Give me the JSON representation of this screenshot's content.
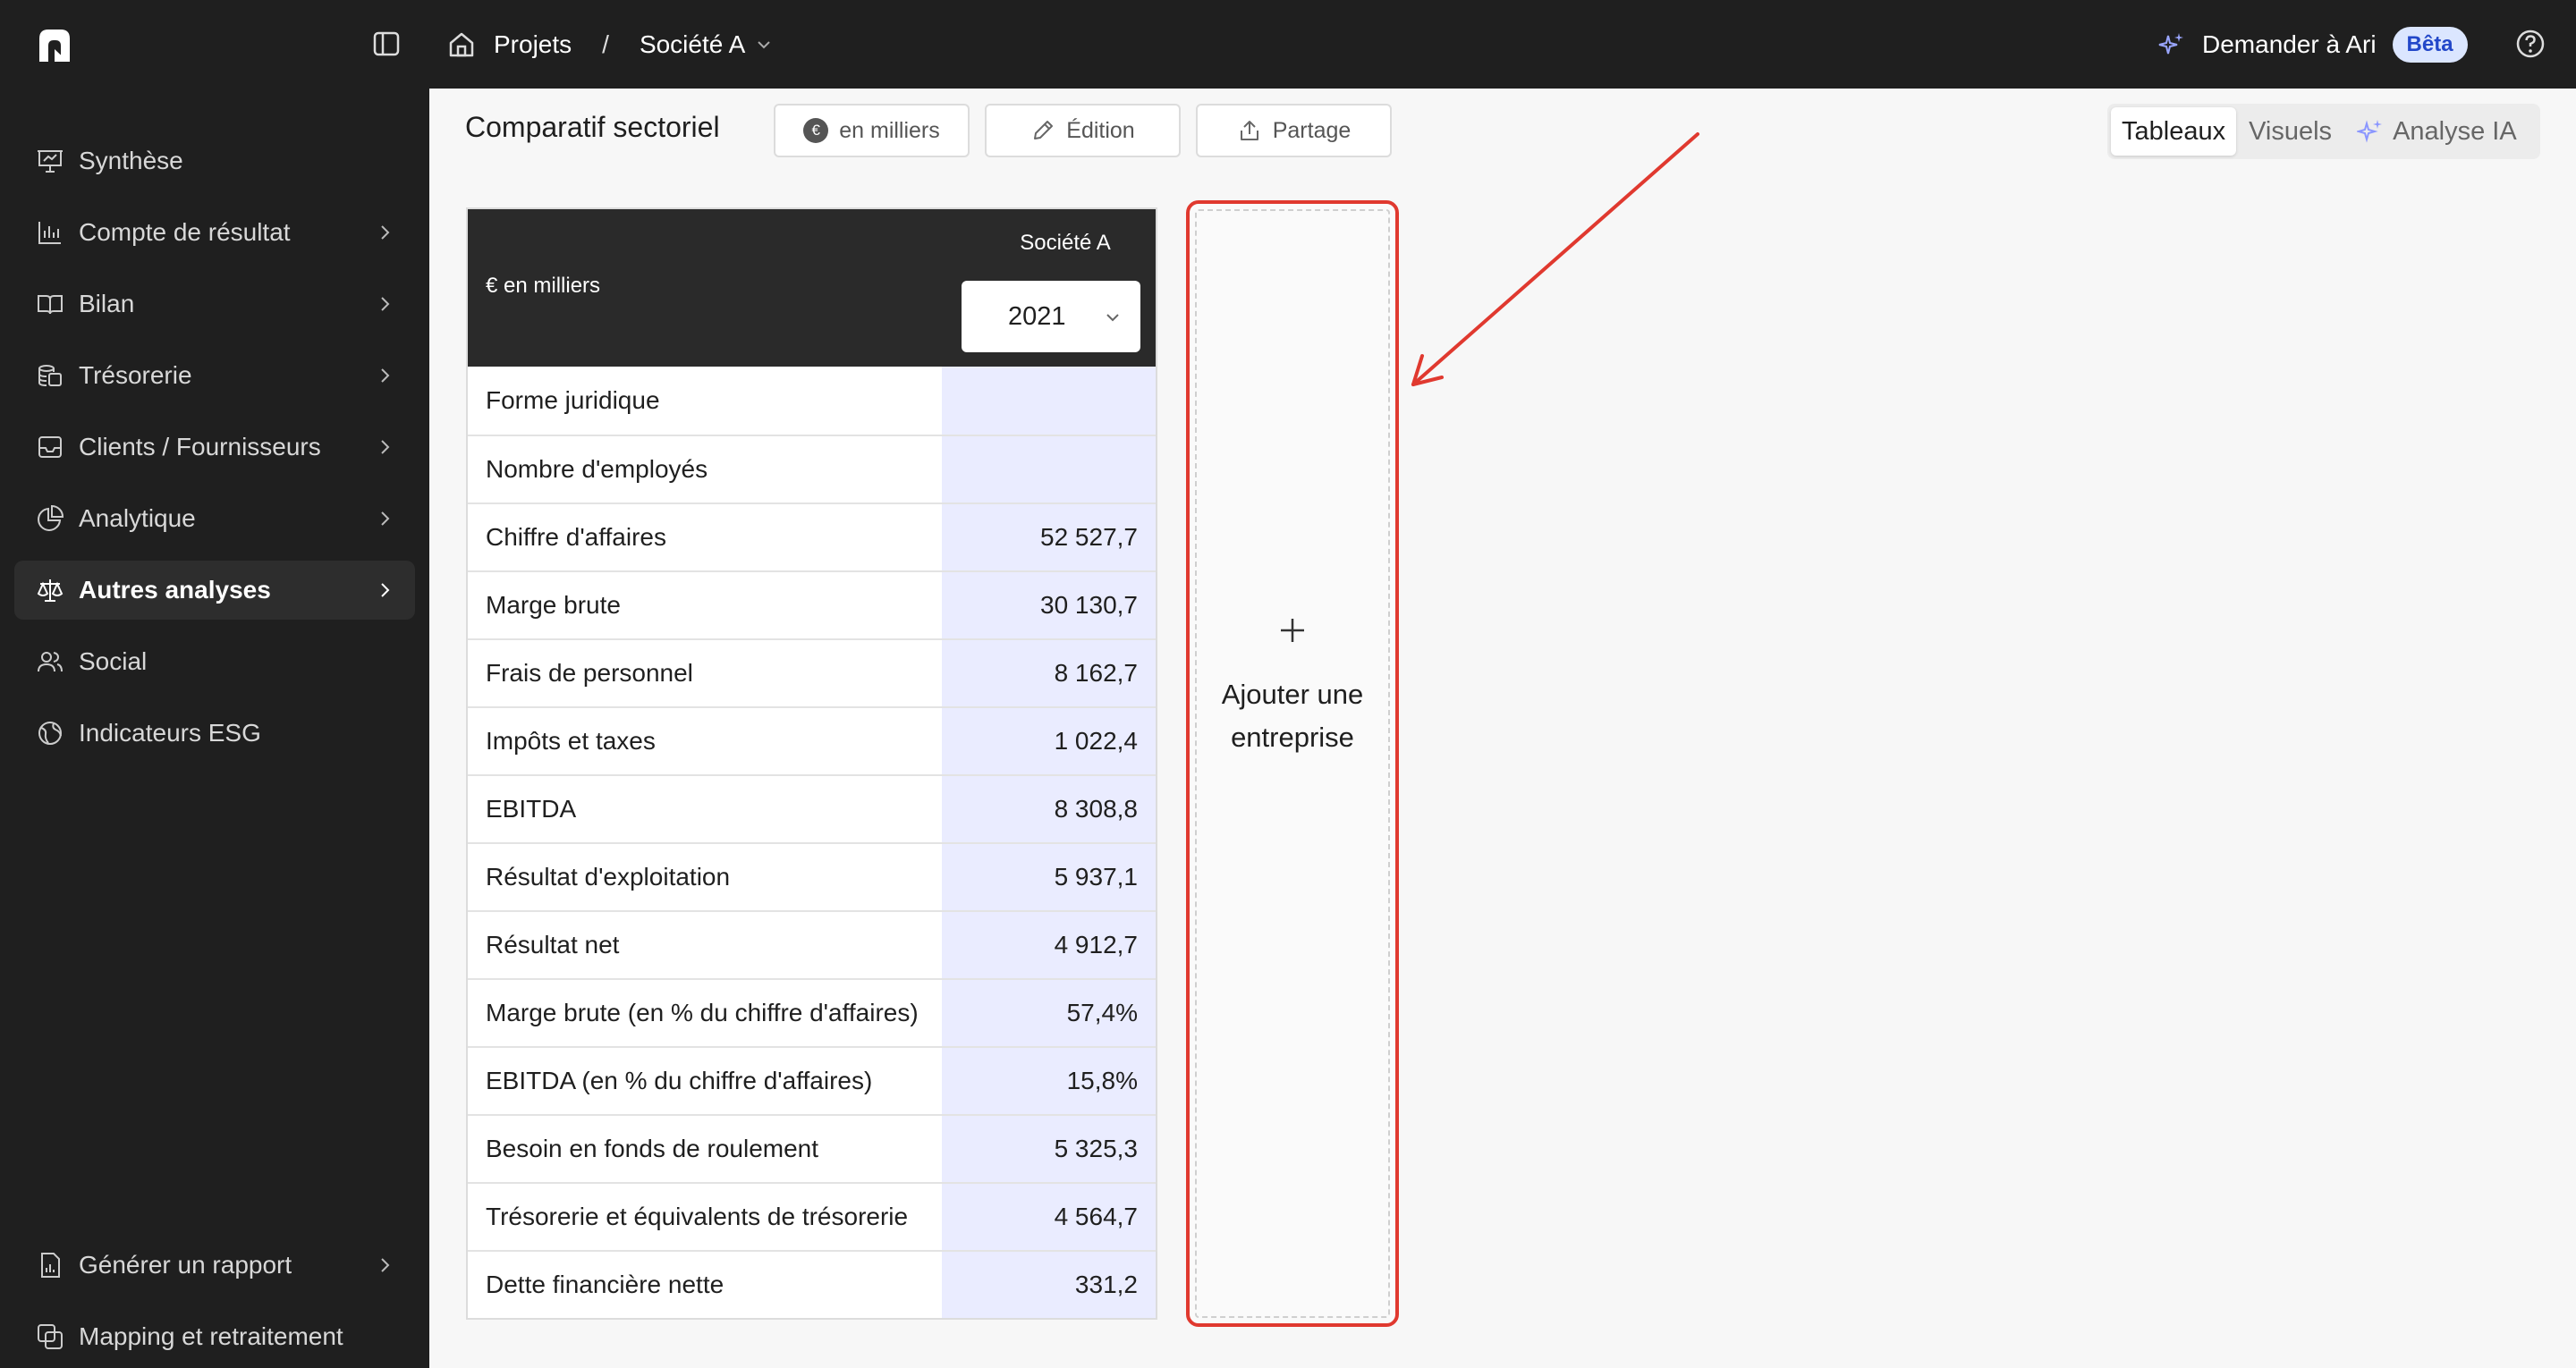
{
  "topbar": {
    "breadcrumb": [
      {
        "label": "Projets"
      },
      {
        "separator": "/"
      },
      {
        "label": "Société A"
      }
    ],
    "ask_ari": "Demander à Ari",
    "beta_badge": "Bêta"
  },
  "sidebar": {
    "items": [
      {
        "label": "Synthèse",
        "icon": "presentation-icon",
        "has_chevron": false
      },
      {
        "label": "Compte de résultat",
        "icon": "bar-chart-icon",
        "has_chevron": true
      },
      {
        "label": "Bilan",
        "icon": "book-icon",
        "has_chevron": true
      },
      {
        "label": "Trésorerie",
        "icon": "coins-icon",
        "has_chevron": true
      },
      {
        "label": "Clients / Fournisseurs",
        "icon": "inbox-icon",
        "has_chevron": true
      },
      {
        "label": "Analytique",
        "icon": "pie-chart-icon",
        "has_chevron": true
      },
      {
        "label": "Autres analyses",
        "icon": "scale-icon",
        "has_chevron": true,
        "active": true
      },
      {
        "label": "Social",
        "icon": "users-icon",
        "has_chevron": false
      },
      {
        "label": "Indicateurs ESG",
        "icon": "globe-icon",
        "has_chevron": false
      }
    ],
    "bottom_items": [
      {
        "label": "Générer un rapport",
        "icon": "report-icon",
        "has_chevron": true
      },
      {
        "label": "Mapping et retraitement",
        "icon": "mapping-icon",
        "has_chevron": false
      }
    ]
  },
  "toolbar": {
    "title": "Comparatif sectoriel",
    "currency_button": "en milliers",
    "currency_symbol": "€",
    "edit_button": "Édition",
    "share_button": "Partage",
    "view_tabs": [
      "Tableaux",
      "Visuels",
      "Analyse IA"
    ],
    "selected_tab": "Tableaux"
  },
  "table": {
    "unit_label": "€ en milliers",
    "company": "Société A",
    "year": "2021",
    "rows": [
      {
        "label": "Forme juridique",
        "value": ""
      },
      {
        "label": "Nombre d'employés",
        "value": ""
      },
      {
        "label": "Chiffre d'affaires",
        "value": "52 527,7"
      },
      {
        "label": "Marge brute",
        "value": "30 130,7"
      },
      {
        "label": "Frais de personnel",
        "value": "8 162,7"
      },
      {
        "label": "Impôts et taxes",
        "value": "1 022,4"
      },
      {
        "label": "EBITDA",
        "value": "8 308,8"
      },
      {
        "label": "Résultat d'exploitation",
        "value": "5 937,1"
      },
      {
        "label": "Résultat net",
        "value": "4 912,7"
      },
      {
        "label": "Marge brute (en % du chiffre d'affaires)",
        "value": "57,4%"
      },
      {
        "label": "EBITDA (en % du chiffre d'affaires)",
        "value": "15,8%"
      },
      {
        "label": "Besoin en fonds de roulement",
        "value": "5 325,3"
      },
      {
        "label": "Trésorerie et équivalents de trésorerie",
        "value": "4 564,7"
      },
      {
        "label": "Dette financière nette",
        "value": "331,2"
      }
    ]
  },
  "add_company": {
    "label": "Ajouter une entreprise"
  },
  "colors": {
    "dark_bg": "#1f1f1f",
    "value_column": "#eaecff",
    "annotation_red": "#e0392f",
    "beta_badge_bg": "#dbe6ff"
  }
}
